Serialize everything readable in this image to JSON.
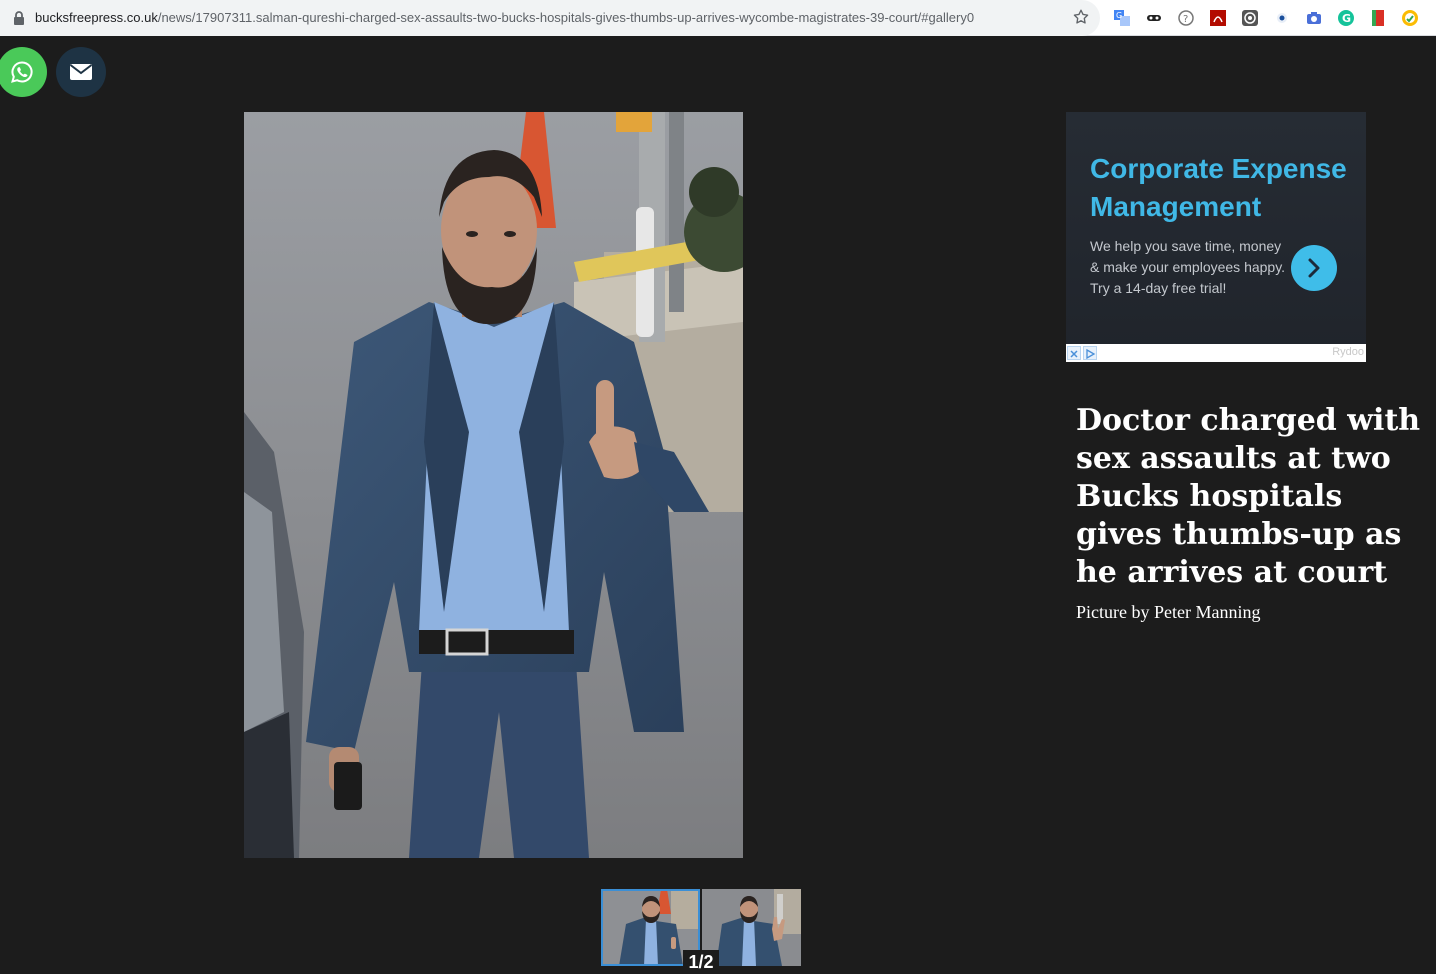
{
  "browser": {
    "url_domain": "bucksfreepress.co.uk",
    "url_path": "/news/17907311.salman-qureshi-charged-sex-assaults-two-bucks-hospitals-gives-thumbs-up-arrives-wycombe-magistrates-39-court/#gallery0",
    "extension_icons": [
      "translate-icon",
      "mask-icon",
      "help-circle-icon",
      "pdf-icon",
      "aperture-icon",
      "eye-icon",
      "camera-icon",
      "grammarly-icon",
      "bookmark-icon",
      "chrome-circle-icon"
    ]
  },
  "share": {
    "whatsapp_icon": "whatsapp-icon",
    "email_icon": "envelope-icon",
    "whatsapp_color": "#4ac959",
    "email_color": "#1e3344"
  },
  "ad": {
    "headline": "Corporate Expense Management",
    "body": "We help you save time, money & make your employees happy. Try a 14-day free trial!",
    "advertiser": "Rydoo",
    "accent_color": "#40b8e6"
  },
  "article": {
    "title": "Doctor charged with sex assaults at two Bucks hospitals gives thumbs-up as he arrives at court",
    "photo_credit": "Picture by Peter Manning"
  },
  "gallery": {
    "counter": "1/2",
    "current": 1,
    "total": 2
  }
}
